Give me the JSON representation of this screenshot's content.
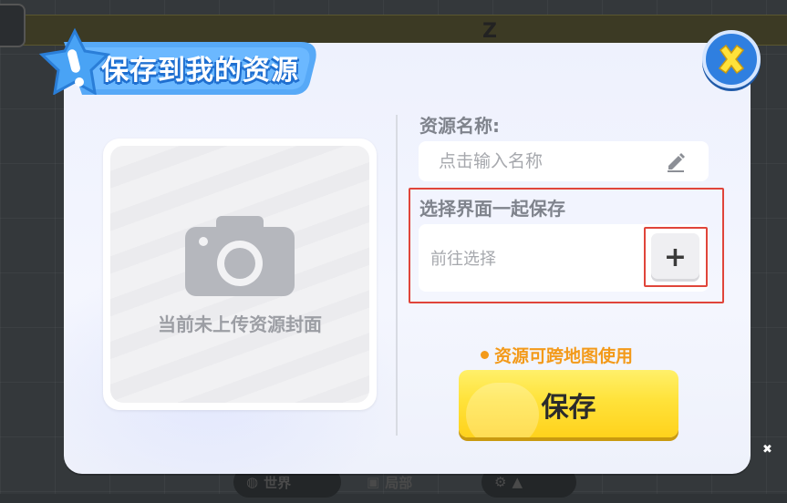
{
  "dialog": {
    "title": "保存到我的资源",
    "close_icon": "close-icon",
    "cover": {
      "label": "当前未上传资源封面",
      "icon": "camera-icon"
    },
    "name_field": {
      "label": "资源名称:",
      "placeholder": "点击输入名称",
      "value": "",
      "icon": "pencil-icon"
    },
    "ui_select": {
      "label": "选择界面一起保存",
      "placeholder": "前往选择",
      "add_icon": "plus-icon",
      "add_label": "+"
    },
    "note": "资源可跨地图使用",
    "save_label": "保存"
  },
  "background": {
    "top_letter": "Z",
    "tabs": [
      {
        "label": "世界",
        "icon": "globe-icon"
      },
      {
        "label": "局部",
        "icon": "cube-icon"
      }
    ]
  },
  "colors": {
    "accent_blue": "#2f7fe0",
    "save_yellow": "#ffe23a",
    "note_orange": "#f39a1a",
    "highlight_red": "#e0453a"
  }
}
